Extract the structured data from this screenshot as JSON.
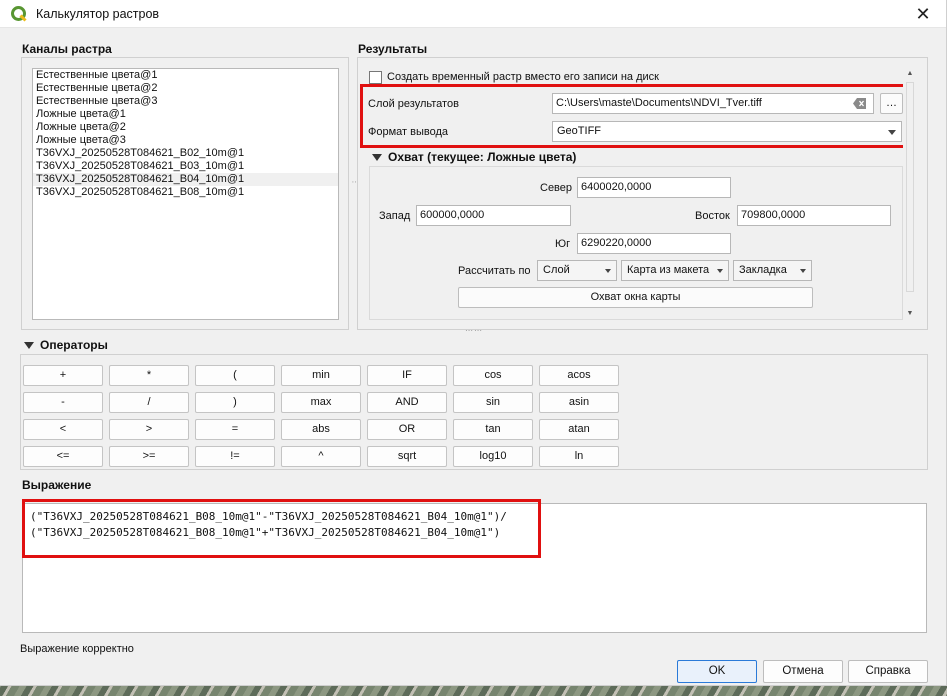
{
  "window": {
    "title": "Калькулятор растров",
    "close_label": "✕"
  },
  "raster_bands": {
    "title": "Каналы растра",
    "items": [
      "Естественные цвета@1",
      "Естественные цвета@2",
      "Естественные цвета@3",
      "Ложные цвета@1",
      "Ложные цвета@2",
      "Ложные цвета@3",
      "T36VXJ_20250528T084621_B02_10m@1",
      "T36VXJ_20250528T084621_B03_10m@1",
      "T36VXJ_20250528T084621_B04_10m@1",
      "T36VXJ_20250528T084621_B08_10m@1"
    ],
    "selected_index": 8
  },
  "results": {
    "title": "Результаты",
    "temp_checkbox_label": "Создать временный растр вместо его записи на диск",
    "output_layer_label": "Слой результатов",
    "output_layer_value": "C:\\Users\\maste\\Documents\\NDVI_Tver.tiff",
    "browse_label": "…",
    "format_label": "Формат вывода",
    "format_value": "GeoTIFF",
    "extent": {
      "title": "Охват (текущее: Ложные цвета)",
      "north_label": "Север",
      "north_value": "6400020,0000",
      "west_label": "Запад",
      "west_value": "600000,0000",
      "east_label": "Восток",
      "east_value": "709800,0000",
      "south_label": "Юг",
      "south_value": "6290220,0000",
      "calc_by_label": "Рассчитать по",
      "layer_btn": "Слой",
      "layout_btn": "Карта из макета",
      "bookmark_btn": "Закладка",
      "map_extent_btn": "Охват окна карты"
    }
  },
  "operators": {
    "title": "Операторы",
    "rows": [
      [
        "+",
        "*",
        "(",
        "min",
        "IF",
        "cos",
        "acos"
      ],
      [
        "-",
        "/",
        ")",
        "max",
        "AND",
        "sin",
        "asin"
      ],
      [
        "<",
        ">",
        "=",
        "abs",
        "OR",
        "tan",
        "atan"
      ],
      [
        "<=",
        ">=",
        "!=",
        "^",
        "sqrt",
        "log10",
        "ln"
      ]
    ]
  },
  "expression": {
    "title": "Выражение",
    "line1": "(\"T36VXJ_20250528T084621_B08_10m@1\"-\"T36VXJ_20250528T084621_B04_10m@1\")/",
    "line2": "(\"T36VXJ_20250528T084621_B08_10m@1\"+\"T36VXJ_20250528T084621_B04_10m@1\")",
    "status": "Выражение корректно"
  },
  "buttons": {
    "ok": "OK",
    "cancel": "Отмена",
    "help": "Справка"
  },
  "colors": {
    "highlight": "#e01010",
    "qgis_green": "#589632",
    "qgis_yellow": "#eebd1c"
  }
}
